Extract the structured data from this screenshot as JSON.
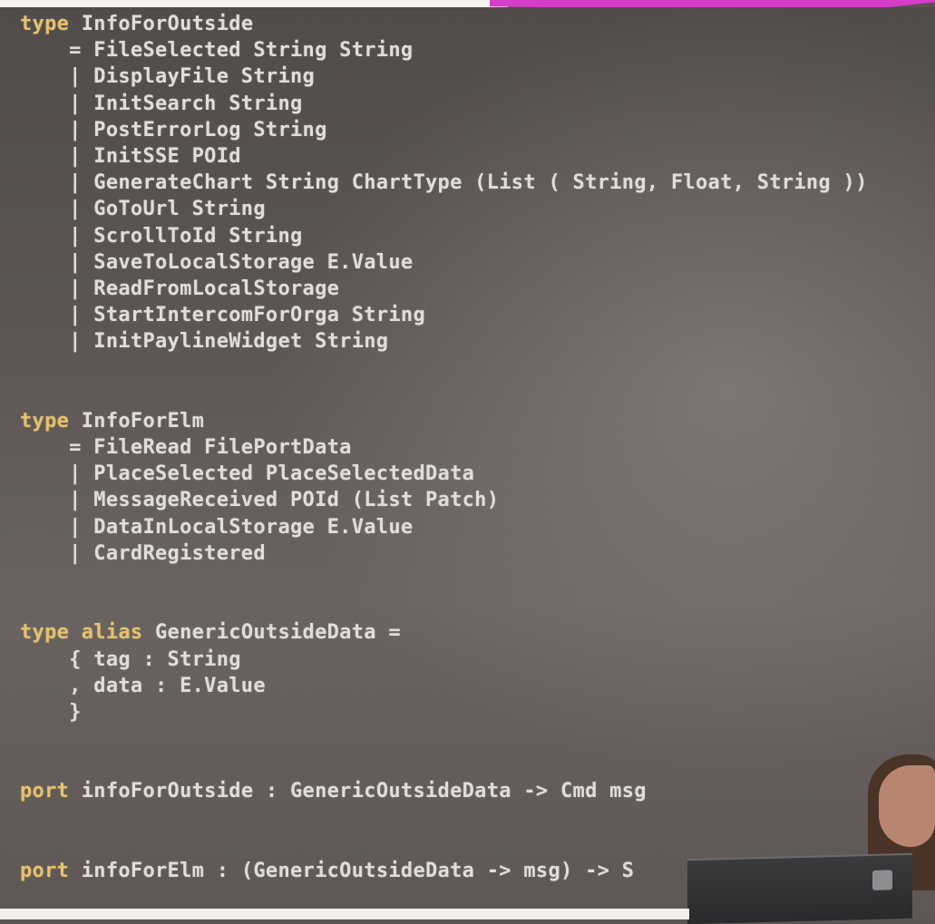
{
  "code": {
    "lines": [
      "type InfoForOutside",
      "    = FileSelected String String",
      "    | DisplayFile String",
      "    | InitSearch String",
      "    | PostErrorLog String",
      "    | InitSSE POId",
      "    | GenerateChart String ChartType (List ( String, Float, String ))",
      "    | GoToUrl String",
      "    | ScrollToId String",
      "    | SaveToLocalStorage E.Value",
      "    | ReadFromLocalStorage",
      "    | StartIntercomForOrga String",
      "    | InitPaylineWidget String",
      "",
      "",
      "type InfoForElm",
      "    = FileRead FilePortData",
      "    | PlaceSelected PlaceSelectedData",
      "    | MessageReceived POId (List Patch)",
      "    | DataInLocalStorage E.Value",
      "    | CardRegistered",
      "",
      "",
      "type alias GenericOutsideData =",
      "    { tag : String",
      "    , data : E.Value",
      "    }",
      "",
      "",
      "port infoForOutside : GenericOutsideData -> Cmd msg",
      "",
      "",
      "port infoForElm : (GenericOutsideData -> msg) -> S"
    ]
  },
  "colors": {
    "keyword": "#e5c36a",
    "text": "#e2ddd8",
    "background": "#5a5452",
    "accent_bar": "#d63ec9"
  }
}
